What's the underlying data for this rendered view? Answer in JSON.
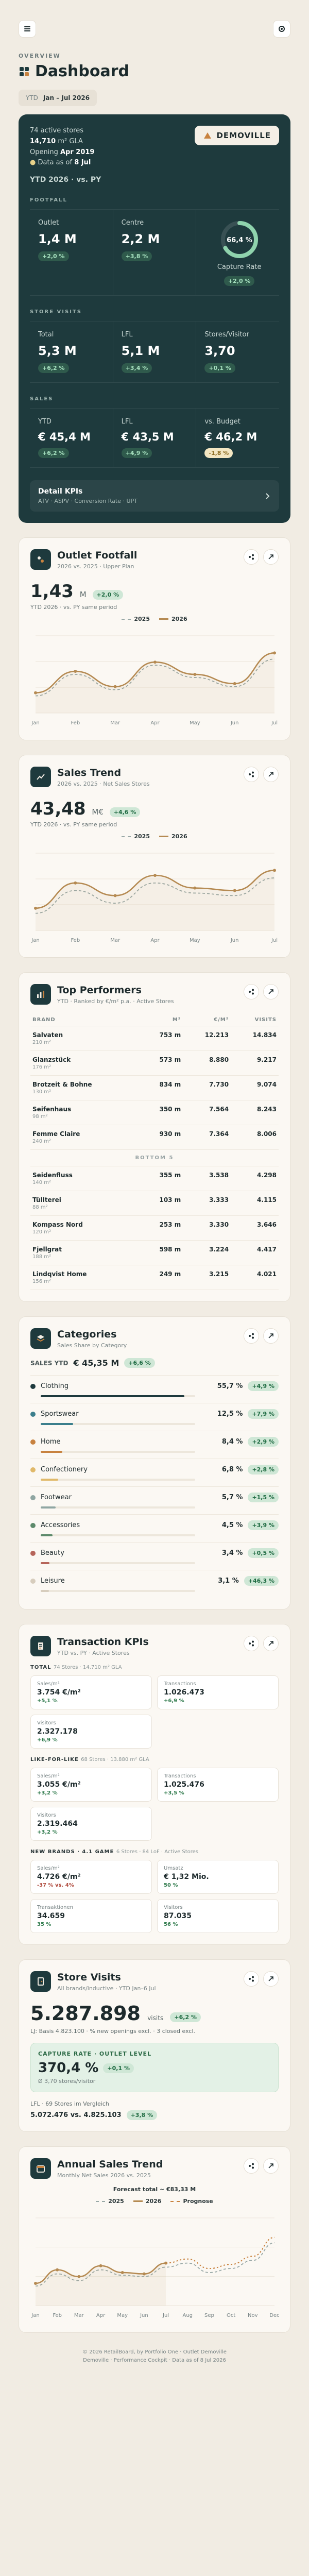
{
  "header": {
    "overline": "OVERVIEW",
    "title": "Dashboard",
    "date_label": "YTD",
    "date_range": "Jan – Jul 2026"
  },
  "hero": {
    "stores": "74 active stores",
    "area_label": "14,710",
    "area_unit": "m² GLA",
    "opening_label": "Opening",
    "opening_value": "Apr 2019",
    "data_label": "Data as of",
    "data_value": "8 Jul",
    "brand": "DEMOVILLE",
    "ytd_line": "YTD 2026 · vs. PY",
    "footfall_label": "FOOTFALL",
    "footfall": [
      {
        "label": "Outlet",
        "value": "1,4 M",
        "delta": "+2,0 %"
      },
      {
        "label": "Centre",
        "value": "2,2 M",
        "delta": "+3,8 %"
      }
    ],
    "capture": {
      "label": "Capture Rate",
      "value": "66,4 %",
      "delta": "+2,0 %",
      "fraction": 0.664
    },
    "visits_label": "STORE VISITS",
    "visits": [
      {
        "label": "Total",
        "value": "5,3 M",
        "delta": "+6,2 %"
      },
      {
        "label": "LFL",
        "value": "5,1 M",
        "delta": "+3,4 %"
      },
      {
        "label": "Stores/Visitor",
        "value": "3,70",
        "delta": "+0,1 %"
      }
    ],
    "sales_label": "SALES",
    "sales": [
      {
        "label": "YTD",
        "value": "€ 45,4 M",
        "delta": "+6,2 %"
      },
      {
        "label": "LFL",
        "value": "€ 43,5 M",
        "delta": "+4,9 %"
      },
      {
        "label": "vs. Budget",
        "value": "€ 46,2 M",
        "delta": "-1,8 %"
      }
    ],
    "detail_title": "Detail KPIs",
    "detail_sub": "ATV · ASPV · Conversion Rate · UPT"
  },
  "outlet_footfall": {
    "title": "Outlet Footfall",
    "sub": "2026 vs. 2025 · Upper Plan",
    "value": "1,43",
    "unit": "M",
    "delta": "+2,0 %",
    "note": "YTD 2026 · vs. PY same period",
    "legend_a": "2025",
    "legend_b": "2026"
  },
  "sales_trend": {
    "title": "Sales Trend",
    "sub": "2026 vs. 2025 · Net Sales Stores",
    "value": "43,48",
    "unit": "M€",
    "delta": "+4,6 %",
    "note": "YTD 2026 · vs. PY same period",
    "legend_a": "2025",
    "legend_b": "2026"
  },
  "chart_data": [
    {
      "type": "line",
      "title": "Outlet Footfall",
      "x": [
        "Jan",
        "Feb",
        "Mar",
        "Apr",
        "May",
        "Jun",
        "Jul"
      ],
      "series": [
        {
          "name": "2025",
          "values": [
            165,
            200,
            175,
            215,
            195,
            180,
            225
          ]
        },
        {
          "name": "2026",
          "values": [
            170,
            205,
            180,
            220,
            200,
            185,
            235
          ]
        }
      ]
    },
    {
      "type": "line",
      "title": "Sales Trend",
      "x": [
        "Jan",
        "Feb",
        "Mar",
        "Apr",
        "May",
        "Jun",
        "Jul"
      ],
      "series": [
        {
          "name": "2025",
          "values": [
            5.2,
            6.1,
            5.6,
            6.4,
            6.0,
            5.9,
            6.6
          ]
        },
        {
          "name": "2026",
          "values": [
            5.4,
            6.4,
            5.9,
            6.7,
            6.2,
            6.1,
            6.9
          ]
        }
      ]
    },
    {
      "type": "line",
      "title": "Annual Sales Trend",
      "x": [
        "Jan",
        "Feb",
        "Mar",
        "Apr",
        "May",
        "Jun",
        "Jul",
        "Aug",
        "Sep",
        "Oct",
        "Nov",
        "Dec"
      ],
      "series": [
        {
          "name": "2025",
          "values": [
            5.2,
            6.1,
            5.6,
            6.4,
            6.0,
            5.9,
            6.6,
            6.9,
            6.2,
            6.5,
            7.1,
            8.4
          ]
        },
        {
          "name": "2026",
          "values": [
            5.4,
            6.4,
            5.9,
            6.7,
            6.2,
            6.1,
            6.9,
            null,
            null,
            null,
            null,
            null
          ]
        },
        {
          "name": "Prognose",
          "values": [
            null,
            null,
            null,
            null,
            null,
            null,
            6.9,
            7.2,
            6.5,
            6.8,
            7.4,
            8.8
          ]
        }
      ]
    }
  ],
  "top_performers": {
    "title": "Top Performers",
    "sub": "YTD · Ranked by €/m² p.a. · Active Stores",
    "columns": [
      "BRAND",
      "M²",
      "€/M²",
      "VISITS"
    ],
    "top": [
      {
        "name": "Salvaten",
        "size": "210 m²",
        "m2": "753 m",
        "eur": "12.213",
        "visits": "14.834"
      },
      {
        "name": "Glanzstück",
        "size": "176 m²",
        "m2": "573 m",
        "eur": "8.880",
        "visits": "9.217"
      },
      {
        "name": "Brotzeit & Bohne",
        "size": "130 m²",
        "m2": "834 m",
        "eur": "7.730",
        "visits": "9.074"
      },
      {
        "name": "Seifenhaus",
        "size": "98 m²",
        "m2": "350 m",
        "eur": "7.564",
        "visits": "8.243"
      },
      {
        "name": "Femme Claire",
        "size": "240 m²",
        "m2": "930 m",
        "eur": "7.364",
        "visits": "8.006"
      }
    ],
    "separator": "BOTTOM 5",
    "bottom": [
      {
        "name": "Seidenfluss",
        "size": "140 m²",
        "m2": "355 m",
        "eur": "3.538",
        "visits": "4.298"
      },
      {
        "name": "Tüllterei",
        "size": "88 m²",
        "m2": "103 m",
        "eur": "3.333",
        "visits": "4.115"
      },
      {
        "name": "Kompass Nord",
        "size": "120 m²",
        "m2": "253 m",
        "eur": "3.330",
        "visits": "3.646"
      },
      {
        "name": "Fjellgrat",
        "size": "188 m²",
        "m2": "598 m",
        "eur": "3.224",
        "visits": "4.417"
      },
      {
        "name": "Lindqvist Home",
        "size": "156 m²",
        "m2": "249 m",
        "eur": "3.215",
        "visits": "4.021"
      }
    ]
  },
  "categories": {
    "title": "Categories",
    "sub": "Sales Share by Category",
    "total_label": "SALES YTD",
    "total_value": "€ 45,35 M",
    "total_delta": "+6,6 %",
    "items": [
      {
        "name": "Clothing",
        "pct": "55,7 %",
        "share": 55.7,
        "delta": "+4,9 %",
        "color": "#1e3a3d"
      },
      {
        "name": "Sportswear",
        "pct": "12,5 %",
        "share": 12.5,
        "delta": "+7,9 %",
        "color": "#3b7f8c"
      },
      {
        "name": "Home",
        "pct": "8,4 %",
        "share": 8.4,
        "delta": "+2,9 %",
        "color": "#c8823f"
      },
      {
        "name": "Confectionery",
        "pct": "6,8 %",
        "share": 6.8,
        "delta": "+2,8 %",
        "color": "#e0b96a"
      },
      {
        "name": "Footwear",
        "pct": "5,7 %",
        "share": 5.7,
        "delta": "+1,5 %",
        "color": "#8fa6a2"
      },
      {
        "name": "Accessories",
        "pct": "4,5 %",
        "share": 4.5,
        "delta": "+3,9 %",
        "color": "#5d8a6b"
      },
      {
        "name": "Beauty",
        "pct": "3,4 %",
        "share": 3.4,
        "delta": "+0,5 %",
        "color": "#b6655a"
      },
      {
        "name": "Leisure",
        "pct": "3,1 %",
        "share": 3.1,
        "delta": "+46,3 %",
        "color": "#d7cdbd"
      }
    ]
  },
  "transactions": {
    "title": "Transaction KPIs",
    "sub": "YTD vs. PY · Active Stores",
    "blocks": [
      {
        "label": "TOTAL",
        "label_sub": "74 Stores · 14.710 m² GLA",
        "cells": [
          {
            "l": "Sales/m²",
            "v": "3.754 €/m²",
            "d": "+5,1 %"
          },
          {
            "l": "Transactions",
            "v": "1.026.473",
            "d": "+6,9 %"
          },
          {
            "l": "Visitors",
            "v": "2.327.178",
            "d": "+6,9 %"
          },
          {
            "l": "",
            "v": "",
            "d": ""
          }
        ]
      },
      {
        "label": "LIKE-FOR-LIKE",
        "label_sub": "68 Stores · 13.880 m² GLA",
        "cells": [
          {
            "l": "Sales/m²",
            "v": "3.055 €/m²",
            "d": "+3,2 %"
          },
          {
            "l": "Transactions",
            "v": "1.025.476",
            "d": "+3,5 %"
          },
          {
            "l": "Visitors",
            "v": "2.319.464",
            "d": "+3,2 %"
          },
          {
            "l": "",
            "v": "",
            "d": ""
          }
        ]
      },
      {
        "label": "NEW BRANDS · 4.1 GAME",
        "label_sub": "6 Stores · 84 LoF · Active Stores",
        "cells": [
          {
            "l": "Sales/m²",
            "v": "4.726 €/m²",
            "d": "-37 % vs. 4%"
          },
          {
            "l": "Umsatz",
            "v": "€ 1,32 Mio.",
            "d": "50 %"
          },
          {
            "l": "Transaktionen",
            "v": "34.659",
            "d": "35 %"
          },
          {
            "l": "Visitors",
            "v": "87.035",
            "d": "56 %"
          }
        ]
      }
    ]
  },
  "store_visits": {
    "title": "Store Visits",
    "sub": "All brands/inductive · YTD Jan–6 Jul",
    "value": "5.287.898",
    "unit": "visits",
    "delta": "+6,2 %",
    "note": "LJ: Basis 4.823.100 · % new openings excl. · 3 closed excl.",
    "cap_label": "CAPTURE RATE · OUTLET LEVEL",
    "cap_value": "370,4 %",
    "cap_delta": "+0,1 %",
    "cap_sub": "Ø 3,70 stores/visitor",
    "lfl_label": "LFL · 69 Stores im Vergleich",
    "lfl_value": "5.072.476 vs. 4.825.103",
    "lfl_delta": "+3,8 %"
  },
  "annual": {
    "title": "Annual Sales Trend",
    "sub": "Monthly Net Sales 2026 vs. 2025",
    "forecast": "Forecast total ~ €83,33 M",
    "legend_a": "2025",
    "legend_b": "2026",
    "legend_c": "Prognose"
  },
  "footer": {
    "line1": "© 2026 RetailBoard, by Portfolio One · Outlet Demoville",
    "line2": "Demoville · Performance Cockpit · Data as of 8 Jul 2026"
  }
}
